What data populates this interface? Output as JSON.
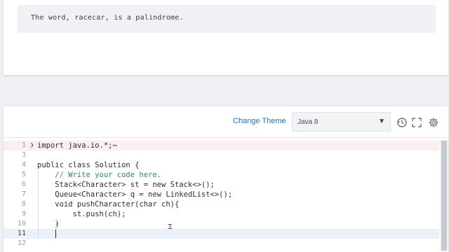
{
  "output": {
    "text": "The word, racecar, is a palindrome."
  },
  "toolbar": {
    "change_theme": "Change Theme",
    "language": "Java 8",
    "icons": [
      "history-icon",
      "fullscreen-icon",
      "settings-icon"
    ]
  },
  "editor": {
    "active_line": 11,
    "lines": [
      {
        "num": "1",
        "text": "import java.io.*;⋯"
      },
      {
        "num": "3",
        "text": ""
      },
      {
        "num": "4",
        "text": "public class Solution {"
      },
      {
        "num": "5",
        "text": "    // Write your code here."
      },
      {
        "num": "6",
        "text": "    Stack<Character> st = new Stack<>();"
      },
      {
        "num": "7",
        "text": "    Queue<Character> q = new LinkedList<>();"
      },
      {
        "num": "8",
        "text": "    void pushCharacter(char ch){"
      },
      {
        "num": "9",
        "text": "        st.push(ch);"
      },
      {
        "num": "10",
        "text": "    }"
      },
      {
        "num": "11",
        "text": ""
      },
      {
        "num": "12",
        "text": ""
      }
    ]
  }
}
